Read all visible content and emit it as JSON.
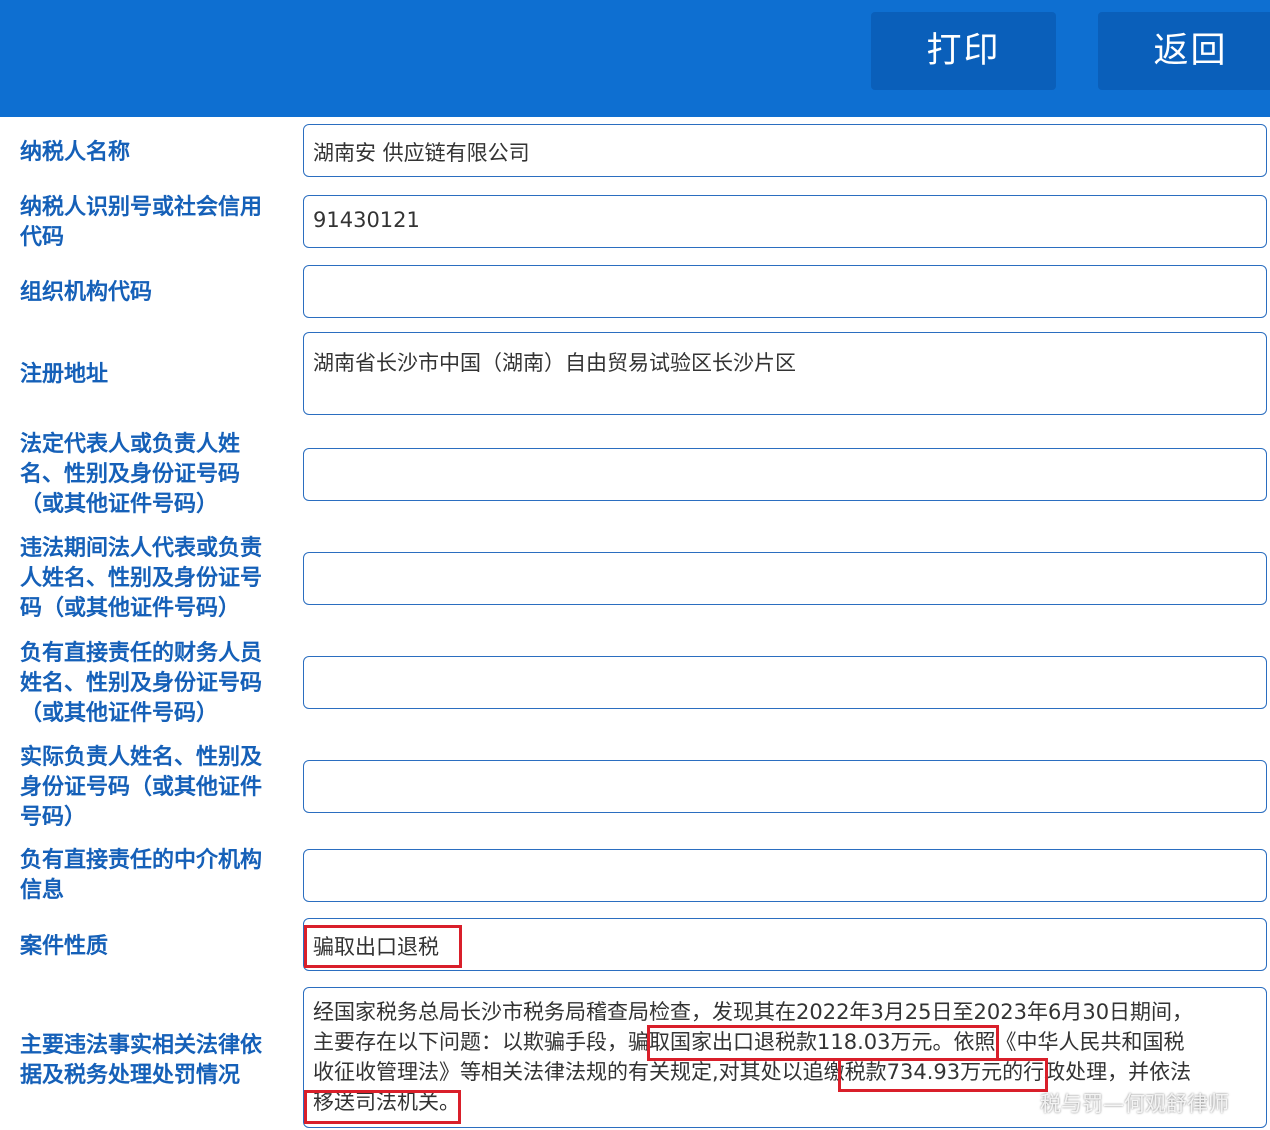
{
  "header": {
    "print_label": "打印",
    "back_label": "返回",
    "bg_color": "#0e6fd1"
  },
  "fields": [
    {
      "label": "纳税人名称",
      "value": "湖南安   供应链有限公司"
    },
    {
      "label": "纳税人识别号或社会信用代码",
      "value": "91430121"
    },
    {
      "label": "组织机构代码",
      "value": ""
    },
    {
      "label": "注册地址",
      "value": "湖南省长沙市中国（湖南）自由贸易试验区长沙片区"
    },
    {
      "label": "法定代表人或负责人姓名、性别及身份证号码（或其他证件号码）",
      "value": ""
    },
    {
      "label": "违法期间法人代表或负责人姓名、性别及身份证号码（或其他证件号码）",
      "value": ""
    },
    {
      "label": "负有直接责任的财务人员姓名、性别及身份证号码（或其他证件号码）",
      "value": ""
    },
    {
      "label": "实际负责人姓名、性别及身份证号码（或其他证件号码）",
      "value": ""
    },
    {
      "label": "负有直接责任的中介机构信息",
      "value": ""
    },
    {
      "label": "案件性质",
      "value": "骗取出口退税"
    },
    {
      "label": "主要违法事实相关法律依据及税务处理处罚情况",
      "lines": [
        "经国家税务总局长沙市税务局稽查局检查，发现其在2022年3月25日至2023年6月30日期间，",
        "主要存在以下问题：以欺骗手段，骗取国家出口退税款118.03万元。依照《中华人民共和国税",
        "收征收管理法》等相关法律法规的有关规定,对其处以追缴税款734.93万元的行政处理，并依法",
        "移送司法机关。"
      ]
    }
  ],
  "watermark": "税与罚—何观舒律师",
  "highlight_color": "#d91f2a",
  "label_color": "#1560b8"
}
